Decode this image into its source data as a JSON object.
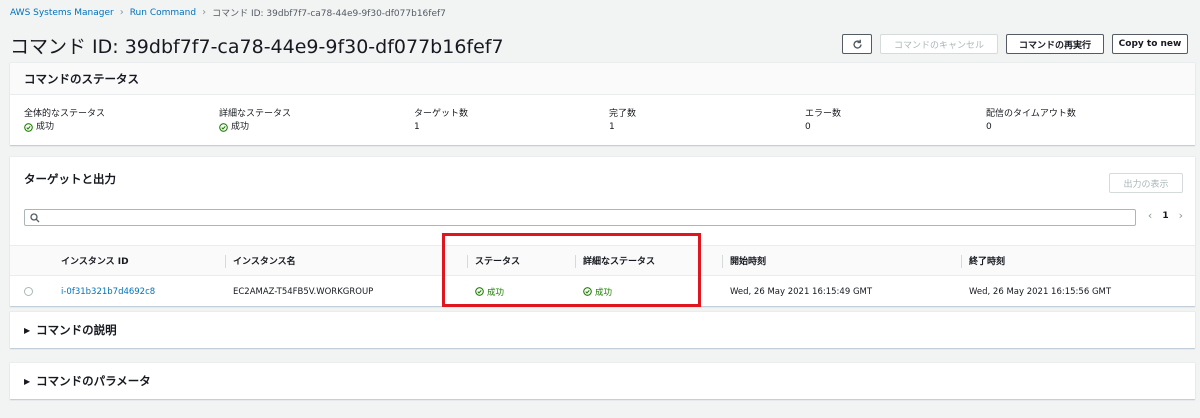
{
  "breadcrumb": {
    "items": [
      "AWS Systems Manager",
      "Run Command"
    ],
    "current": "コマンド ID: 39dbf7f7-ca78-44e9-9f30-df077b16fef7"
  },
  "page": {
    "title": "コマンド ID: 39dbf7f7-ca78-44e9-9f30-df077b16fef7"
  },
  "actions": {
    "refresh_icon": "refresh-icon",
    "cancel_label": "コマンドのキャンセル",
    "rerun_label": "コマンドの再実行",
    "copy_label": "Copy to new"
  },
  "status_panel": {
    "title": "コマンドのステータス",
    "fields": [
      {
        "label": "全体的なステータス",
        "value": "成功"
      },
      {
        "label": "詳細なステータス",
        "value": "成功"
      },
      {
        "label": "ターゲット数",
        "value": "1"
      },
      {
        "label": "完了数",
        "value": "1"
      },
      {
        "label": "エラー数",
        "value": "0"
      },
      {
        "label": "配信のタイムアウト数",
        "value": "0"
      }
    ]
  },
  "targets_panel": {
    "title": "ターゲットと出力",
    "show_output_label": "出力の表示",
    "pager": {
      "prev": "‹",
      "page": "1",
      "next": "›"
    },
    "columns": [
      "インスタンス ID",
      "インスタンス名",
      "ステータス",
      "詳細なステータス",
      "開始時刻",
      "終了時刻"
    ],
    "rows": [
      {
        "instance_id": "i-0f31b321b7d4692c8",
        "instance_name": "EC2AMAZ-T54FB5V.WORKGROUP",
        "status": "成功",
        "detailed_status": "成功",
        "start_time": "Wed, 26 May 2021 16:15:49 GMT",
        "end_time": "Wed, 26 May 2021 16:15:56 GMT"
      }
    ]
  },
  "description_panel": {
    "title": "コマンドの説明"
  },
  "parameters_panel": {
    "title": "コマンドのパラメータ"
  },
  "colors": {
    "success": "#1d8102",
    "link": "#0073bb",
    "highlight": "#e0161e"
  }
}
